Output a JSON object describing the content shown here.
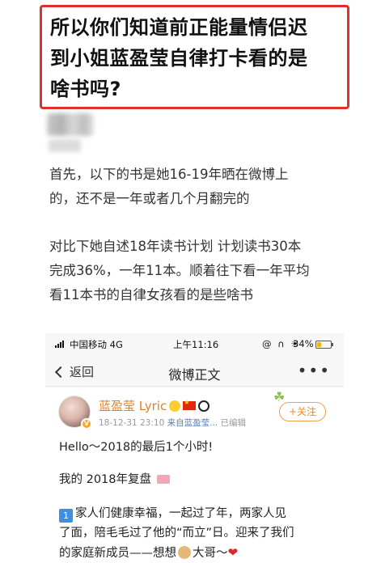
{
  "title": {
    "lines": [
      "所以你们知道前正能量情侣迟",
      "到小姐蓝盈莹自律打卡看的是",
      "啥书吗?"
    ]
  },
  "paragraphs": [
    [
      "首先，以下的书是她16-19年晒在微博上",
      "的，还不是一年或者几个月翻完的"
    ],
    [
      "对比下她自述18年读书计划 计划读书30本",
      "完成36%，一年11本。顺着往下看一年平均",
      "看11本书的自律女孩看的是些啥书"
    ]
  ],
  "phone": {
    "status": {
      "carrier": "中国移动 4G",
      "time": "上午11:16",
      "icons": "@ ∩ ☀",
      "battery_pct": "34%",
      "battery_level": 0.34,
      "battery_color": "#f2b705"
    },
    "nav": {
      "back_label": "返回",
      "title": "微博正文",
      "more_label": "•••"
    },
    "post": {
      "username": "蓝盈莹 Lyric",
      "verified_badge": "V",
      "timestamp": "18-12-31 23:10",
      "source": "来自蓝盈莹...",
      "edited": "已编辑",
      "follow_label": "+关注",
      "line1": "Hello～2018的最后1个小时!",
      "line2": "我的 2018年复盘",
      "item_number": "1",
      "line3a": "家人们健康幸福，一起过了年，两家人见",
      "line3b": "了面，陪毛毛过了他的“而立”日。迎来了我们",
      "line3c_pre": "的家庭新成员——想想",
      "line3c_post": "大哥～",
      "heart": "❤"
    }
  },
  "colors": {
    "title_border": "#e0302e",
    "username": "#e6821e",
    "follow": "#f08a24"
  }
}
